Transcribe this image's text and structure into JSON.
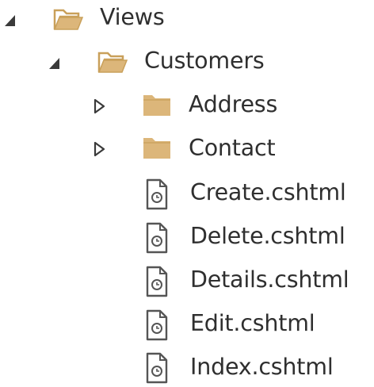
{
  "tree": {
    "views": {
      "label": "Views",
      "expanded": true,
      "icon": "open-folder-icon"
    },
    "customers": {
      "label": "Customers",
      "expanded": true,
      "icon": "open-folder-icon"
    },
    "address": {
      "label": "Address",
      "expanded": false,
      "icon": "closed-folder-icon"
    },
    "contact": {
      "label": "Contact",
      "expanded": false,
      "icon": "closed-folder-icon"
    },
    "files": [
      {
        "label": "Create.cshtml",
        "icon": "razor-file-icon"
      },
      {
        "label": "Delete.cshtml",
        "icon": "razor-file-icon"
      },
      {
        "label": "Details.cshtml",
        "icon": "razor-file-icon"
      },
      {
        "label": "Edit.cshtml",
        "icon": "razor-file-icon"
      },
      {
        "label": "Index.cshtml",
        "icon": "razor-file-icon"
      }
    ]
  },
  "colors": {
    "folder": "#dcb67a",
    "folder_dark": "#c9a05a",
    "text": "#2f2f2f",
    "arrow": "#3a3a3a",
    "file_outline": "#555555"
  }
}
